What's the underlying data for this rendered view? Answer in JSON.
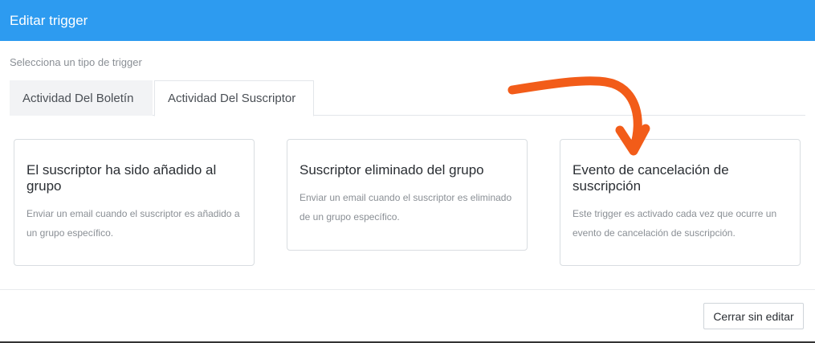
{
  "header": {
    "title": "Editar trigger",
    "background": "#2d9bf0"
  },
  "subtitle": "Selecciona un tipo de trigger",
  "tabs": [
    {
      "label": "Actividad Del Boletín",
      "active": false
    },
    {
      "label": "Actividad Del Suscriptor",
      "active": true
    }
  ],
  "cards": [
    {
      "title": "El suscriptor ha sido añadido al grupo",
      "description": "Enviar un email cuando el suscriptor es añadido a un grupo específico."
    },
    {
      "title": "Suscriptor eliminado del grupo",
      "description": "Enviar un email cuando el suscriptor es eliminado de un grupo específico."
    },
    {
      "title": "Evento de cancelación de suscripción",
      "description": "Este trigger es activado cada vez que ocurre un evento de cancelación de suscripción."
    }
  ],
  "footer": {
    "close_label": "Cerrar sin editar"
  },
  "annotation": {
    "arrow_color": "#f25c19"
  }
}
